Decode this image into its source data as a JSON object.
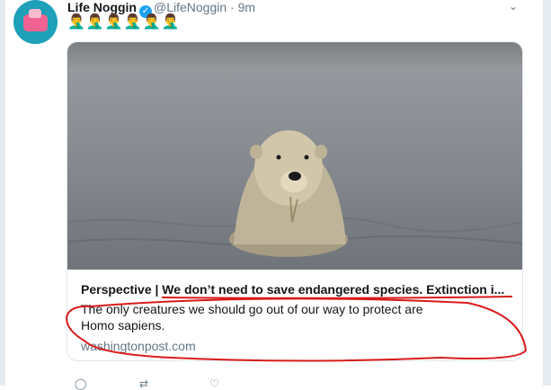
{
  "tweet": {
    "display_name": "Life Noggin",
    "handle": "@LifeNoggin",
    "separator": "·",
    "time": "9m",
    "emojis": "🤦‍♂️🤦‍♂️🤦‍♂️🤦‍♂️🤦‍♂️🤦‍♂️"
  },
  "card": {
    "title": "Perspective | We don’t need to save endangered species. Extinction i...",
    "description": "The only creatures we should go out of our way to protect are Homo sapiens.",
    "domain": "washingtonpost.com",
    "image_subject": "polar bear swimming in water"
  },
  "icons": {
    "verified": "verified-badge-icon",
    "caret": "chevron-down-icon",
    "reply": "reply-icon",
    "retweet": "retweet-icon",
    "like": "heart-icon"
  },
  "colors": {
    "link_blue": "#1da1f2",
    "secondary_text": "#657786",
    "annotation_red": "#d81b1b"
  }
}
